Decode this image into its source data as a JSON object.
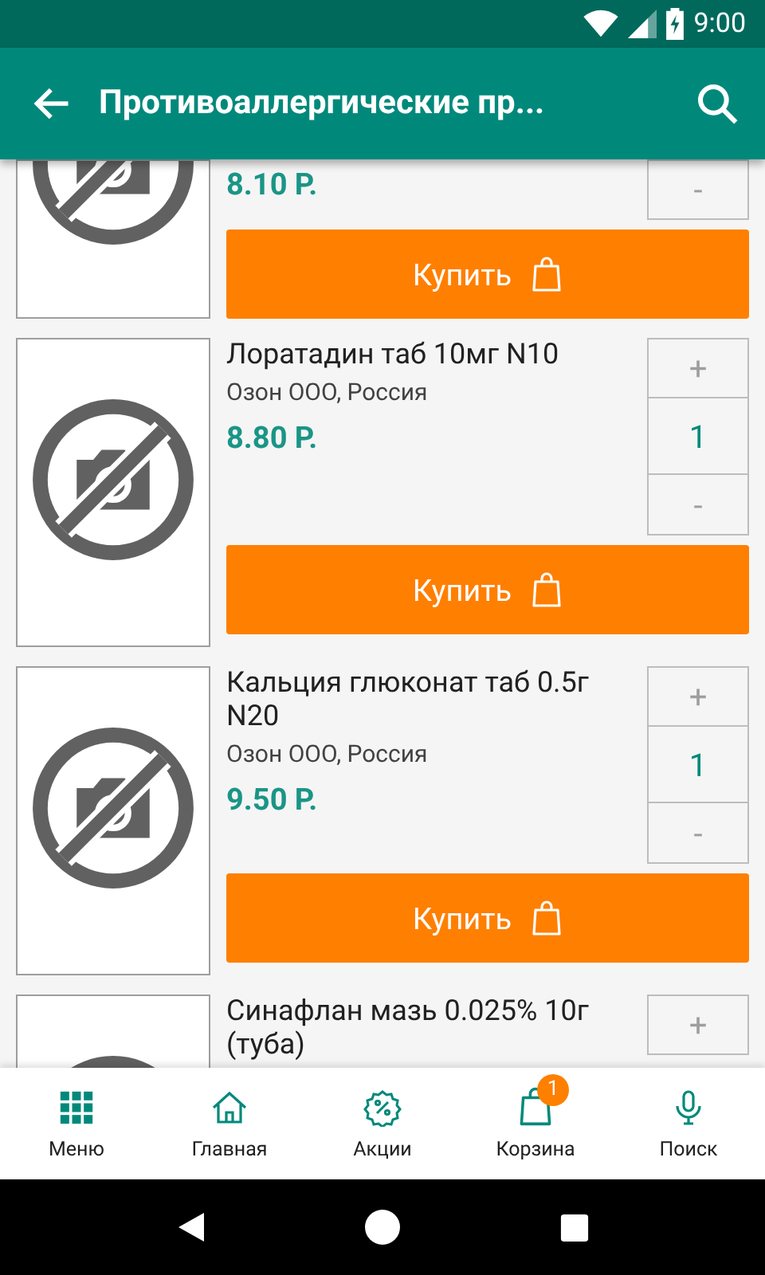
{
  "status_bar": {
    "time": "9:00"
  },
  "app_bar": {
    "title": "Противоаллергические пр..."
  },
  "products": [
    {
      "price": "8.10 Р.",
      "stepper": [
        {
          "kind": "minus",
          "label": "-"
        }
      ],
      "buy_label": "Купить"
    },
    {
      "title": "Лоратадин таб 10мг N10",
      "maker": "Озон ООО, Россия",
      "price": "8.80 Р.",
      "stepper": [
        {
          "kind": "plus",
          "label": "+"
        },
        {
          "kind": "count",
          "label": "1"
        },
        {
          "kind": "minus",
          "label": "-"
        }
      ],
      "buy_label": "Купить"
    },
    {
      "title": "Кальция глюконат таб 0.5г N20",
      "maker": "Озон ООО, Россия",
      "price": "9.50 Р.",
      "stepper": [
        {
          "kind": "plus",
          "label": "+"
        },
        {
          "kind": "count",
          "label": "1"
        },
        {
          "kind": "minus",
          "label": "-"
        }
      ],
      "buy_label": "Купить"
    },
    {
      "title": "Синафлан мазь 0.025% 10г (туба)",
      "stepper": [
        {
          "kind": "plus",
          "label": "+"
        }
      ]
    }
  ],
  "bottom_nav": [
    {
      "kind": "menu",
      "label": "Меню"
    },
    {
      "kind": "home",
      "label": "Главная"
    },
    {
      "kind": "sale",
      "label": "Акции"
    },
    {
      "kind": "cart",
      "label": "Корзина",
      "badge": "1"
    },
    {
      "kind": "voice",
      "label": "Поиск"
    }
  ]
}
